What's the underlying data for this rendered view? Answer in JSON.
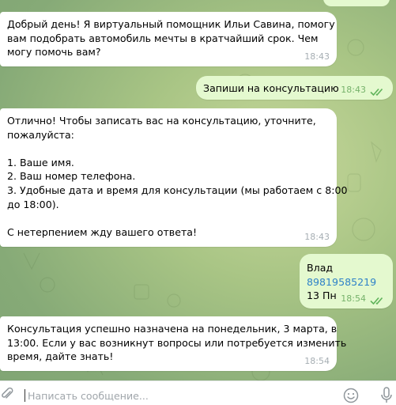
{
  "messages": [
    {
      "direction": "incoming",
      "lines": [
        "Добрый день! Я виртуальный помощник Ильи Савина, помогу",
        "вам подобрать автомобиль мечты в кратчайший срок. Чем",
        "могу помочь вам?"
      ],
      "time": "18:43"
    },
    {
      "direction": "outgoing",
      "lines": [
        "Запиши на консультацию"
      ],
      "time": "18:43",
      "status": "read"
    },
    {
      "direction": "incoming",
      "lines": [
        "Отлично! Чтобы записать вас на консультацию, уточните,",
        "пожалуйста:",
        "",
        "1. Ваше имя.",
        "2. Ваш номер телефона.",
        "3. Удобные дата и время для консультации (мы работаем с 8:00",
        "до 18:00).",
        "",
        "С нетерпением жду вашего ответа!"
      ],
      "time": "18:43"
    },
    {
      "direction": "outgoing",
      "lines": [
        "Влад",
        "89819585219",
        "13 Пн"
      ],
      "link_line": "89819585219",
      "time": "18:54",
      "status": "read"
    },
    {
      "direction": "incoming",
      "lines": [
        "Консультация успешно назначена на понедельник, 3 марта, в",
        "13:00. Если у вас возникнут вопросы или потребуется изменить",
        "время, дайте знать!"
      ],
      "time": "18:54"
    }
  ],
  "composer": {
    "placeholder": "Написать сообщение...",
    "attach_icon": "paperclip-icon",
    "emoji_icon": "smile-icon",
    "mic_icon": "microphone-icon"
  },
  "colors": {
    "incoming_bubble": "#ffffff",
    "outgoing_bubble": "#e4f9cf",
    "outgoing_time": "#76b26b",
    "link": "#2f82c8"
  }
}
